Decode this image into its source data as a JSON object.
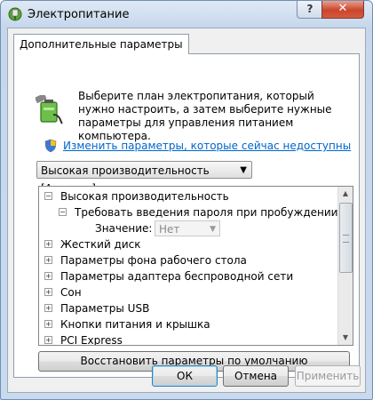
{
  "window": {
    "title": "Электропитание",
    "help_label": "?",
    "close_label": "✕"
  },
  "tab": {
    "label": "Дополнительные параметры"
  },
  "description": "Выберите план электропитания, который нужно настроить, а затем выберите нужные параметры для управления питанием компьютера.",
  "link": {
    "label": "Изменить параметры, которые сейчас недоступны"
  },
  "plan_select": {
    "value": "Высокая производительность [Активен]"
  },
  "tree": {
    "items": [
      {
        "label": "Высокая производительность",
        "expander": "⊟"
      },
      {
        "label": "Требовать введения пароля при пробуждении",
        "expander": "⊟"
      },
      {
        "label": "Значение:"
      },
      {
        "label": "Жесткий диск",
        "expander": "⊞"
      },
      {
        "label": "Параметры фона рабочего стола",
        "expander": "⊞"
      },
      {
        "label": "Параметры адаптера беспроводной сети",
        "expander": "⊞"
      },
      {
        "label": "Сон",
        "expander": "⊞"
      },
      {
        "label": "Параметры USB",
        "expander": "⊞"
      },
      {
        "label": "Кнопки питания и крышка",
        "expander": "⊞"
      },
      {
        "label": "PCI Express",
        "expander": "⊞"
      }
    ],
    "value_select": "Нет"
  },
  "restore_button": {
    "label": "Восстановить параметры по умолчанию"
  },
  "buttons": {
    "ok": "ОК",
    "cancel": "Отмена",
    "apply": "Применить"
  },
  "icons": {
    "title": "power-plug-icon",
    "plan": "battery-plug-icon",
    "shield": "uac-shield-icon"
  },
  "colors": {
    "link": "#0066cc",
    "close": "#c9462c"
  }
}
